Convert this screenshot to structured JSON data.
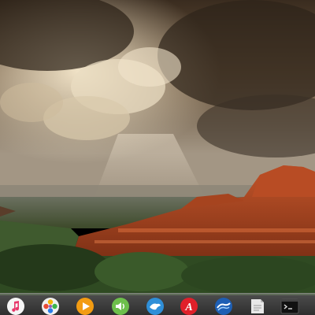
{
  "desktop": {
    "wallpaper": "red-rock-canyon-storm-clouds",
    "dock": {
      "items": [
        {
          "name": "music-app",
          "icon": "music-note-icon",
          "color": "#f5f5f5"
        },
        {
          "name": "photos-app",
          "icon": "photos-flower-icon",
          "color": "#f0f0f0"
        },
        {
          "name": "media-player-app",
          "icon": "play-icon",
          "color": "#f39c12"
        },
        {
          "name": "audio-app",
          "icon": "speaker-icon",
          "color": "#6dbf4b"
        },
        {
          "name": "messaging-app",
          "icon": "bird-icon",
          "color": "#2f8fd8"
        },
        {
          "name": "authoring-app",
          "icon": "letter-a-icon",
          "color": "#e0202a"
        },
        {
          "name": "browser-app",
          "icon": "wave-globe-icon",
          "color": "#1e5fb4"
        },
        {
          "name": "notes-app",
          "icon": "note-paper-icon",
          "color": "#e8e8e8"
        },
        {
          "name": "terminal-app",
          "icon": "terminal-icon",
          "color": "#111111"
        }
      ],
      "label_a": "A"
    }
  }
}
